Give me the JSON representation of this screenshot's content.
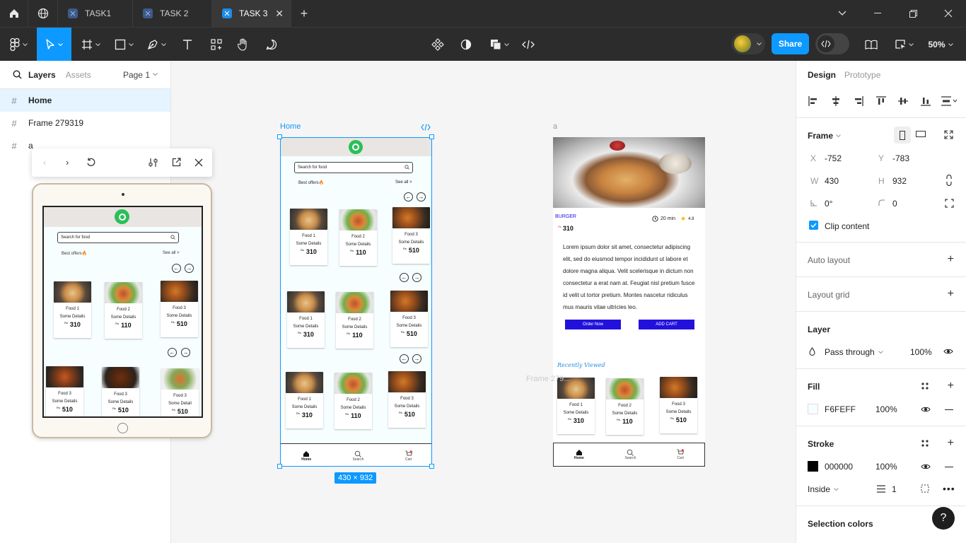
{
  "titlebar": {
    "tabs": [
      {
        "label": "TASK1"
      },
      {
        "label": "TASK 2"
      },
      {
        "label": "TASK 3"
      }
    ]
  },
  "toolbar": {
    "share_label": "Share",
    "zoom": "50%"
  },
  "left_panel": {
    "tab_layers": "Layers",
    "tab_assets": "Assets",
    "page_label": "Page 1",
    "layers": [
      {
        "label": "Home"
      },
      {
        "label": "Frame 279319"
      },
      {
        "label": "a"
      }
    ]
  },
  "canvas": {
    "home_label": "Home",
    "a_label": "a",
    "frame_ghost_label": "Frame 279...",
    "size_badge": "430 × 932",
    "app": {
      "search_placeholder": "Search for food",
      "best_offers": "Best offers🔥",
      "see_all": "See all >",
      "cards": [
        {
          "name": "Food 1",
          "details": "Some  Details",
          "currency": "Rs",
          "price": "310"
        },
        {
          "name": "Food 2",
          "details": "Some  Details",
          "currency": "Rs",
          "price": "110"
        },
        {
          "name": "Food 3",
          "details": "Some  Details",
          "currency": "Rs",
          "price": "510"
        }
      ],
      "nav": [
        "Home",
        "Search",
        "Cart"
      ]
    },
    "detail": {
      "category": "BURGER",
      "time": "20 min",
      "rating": "4.8",
      "currency": "Rs",
      "price": "310",
      "description": "Lorem ipsum dolor sit amet, consectetur adipiscing elit, sed do eiusmod tempor incididunt ut labore et dolore magna aliqua. Velit scelerisque in dictum non consectetur a erat nam at. Feugiat nisl pretium fusce id velit ut tortor pretium. Montes nascetur ridiculus mus mauris vitae ultricies leo.",
      "order_btn": "Order Now",
      "cart_btn": "ADD CART",
      "recently_viewed": "Recently Viewed"
    },
    "tablet": {
      "search_placeholder": "Search for food",
      "best_offers": "Best offers🔥",
      "see_all": "See all >",
      "cards": [
        {
          "name": "Food 1",
          "details": "Some  Details",
          "currency": "Rs",
          "price": "310"
        },
        {
          "name": "Food 2",
          "details": "Some  Details",
          "currency": "Rs",
          "price": "110"
        },
        {
          "name": "Food 3",
          "details": "Some  Details",
          "currency": "Rs",
          "price": "510"
        }
      ],
      "row2": [
        {
          "name": "Food 3",
          "details": "Some  Details",
          "price": "510"
        },
        {
          "name": "Food 3",
          "details": "Some  Details",
          "price": "510"
        },
        {
          "name": "Food 3",
          "details": "Some  Detail",
          "price": "510"
        }
      ]
    }
  },
  "right_panel": {
    "tab_design": "Design",
    "tab_prototype": "Prototype",
    "frame_label": "Frame",
    "x_label": "X",
    "x_val": "-752",
    "y_label": "Y",
    "y_val": "-783",
    "w_label": "W",
    "w_val": "430",
    "h_label": "H",
    "h_val": "932",
    "rotation": "0°",
    "radius": "0",
    "clip_content": "Clip content",
    "auto_layout": "Auto layout",
    "layout_grid": "Layout grid",
    "layer_title": "Layer",
    "blend_mode": "Pass through",
    "layer_opacity": "100%",
    "fill_title": "Fill",
    "fill_hex": "F6FEFF",
    "fill_opacity": "100%",
    "stroke_title": "Stroke",
    "stroke_hex": "000000",
    "stroke_opacity": "100%",
    "stroke_position": "Inside",
    "stroke_weight": "1",
    "selection_colors": "Selection colors",
    "help": "?"
  },
  "colors": {
    "accent": "#0d99ff",
    "fill": "#F6FEFF",
    "stroke": "#000000",
    "brand_green": "#2bbf5a",
    "button_blue": "#2211dd"
  }
}
